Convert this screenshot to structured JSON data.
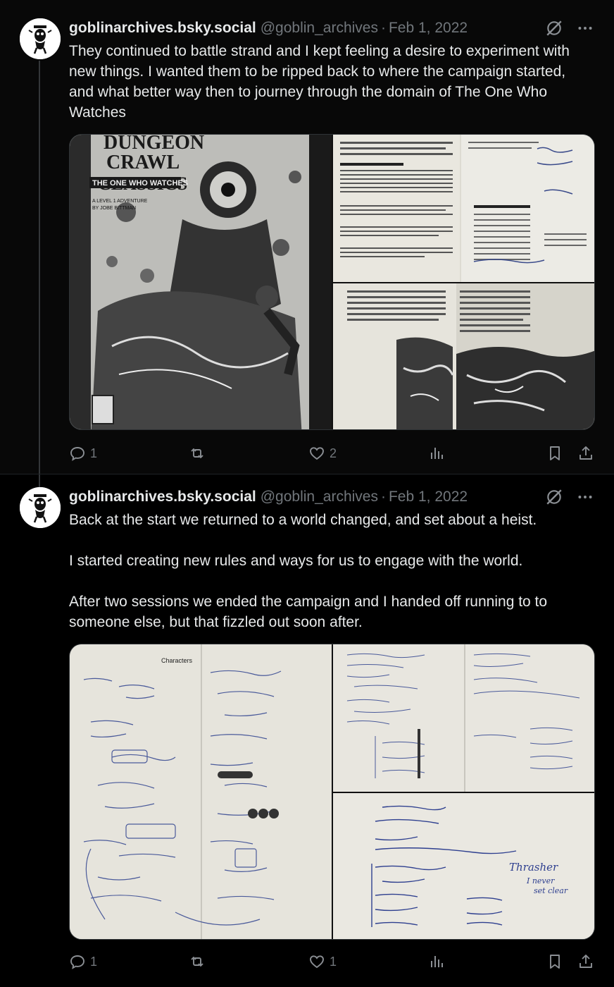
{
  "tweets": [
    {
      "display_name": "goblinarchives.bsky.social",
      "handle": "@goblin_archives",
      "separator": "·",
      "date": "Feb 1, 2022",
      "text": [
        "They continued to battle strand and I kept feeling a desire to experiment with new things. I wanted them to be ripped back to where the campaign started, and what better way then to journey through the domain of The One Who Watches"
      ],
      "media": [
        {
          "name": "dungeon-crawl-classics-cover-photo"
        },
        {
          "name": "random-encounter-table-photo"
        },
        {
          "name": "area-map-page-photo"
        }
      ],
      "cover_text": {
        "title1": "DUNGEON",
        "title2": "CRAWL",
        "title3": "CLASSICS",
        "subtitle": "THE ONE WHO WATCHES",
        "level": "A LEVEL 1 ADVENTURE",
        "author": "BY JOBE BITTMAN"
      },
      "replies": "1",
      "reposts": "",
      "likes": "2"
    },
    {
      "display_name": "goblinarchives.bsky.social",
      "handle": "@goblin_archives",
      "separator": "·",
      "date": "Feb 1, 2022",
      "text": [
        "Back at the start we returned to a world changed, and set about a heist.",
        "",
        "I started creating new rules and ways for us to engage with the world.",
        "",
        "After two sessions we ended the campaign and I handed off running to to someone else, but that fizzled out soon after."
      ],
      "media": [
        {
          "name": "handwritten-notes-characters-photo"
        },
        {
          "name": "handwritten-notes-spread-photo"
        },
        {
          "name": "handwritten-notes-thrasher-photo"
        }
      ],
      "notes_text": {
        "characters": "Characters",
        "thrasher": "Thrasher",
        "never": "I never",
        "set_clear": "set clear"
      },
      "replies": "1",
      "reposts": "",
      "likes": "1"
    }
  ],
  "colors": {
    "background": "#000000",
    "text": "#e7e9ea",
    "muted": "#71767b"
  },
  "icons": [
    "avatar-goblin-icon",
    "grok-icon",
    "more-icon",
    "reply-icon",
    "repost-icon",
    "like-icon",
    "views-icon",
    "bookmark-icon",
    "share-icon"
  ]
}
